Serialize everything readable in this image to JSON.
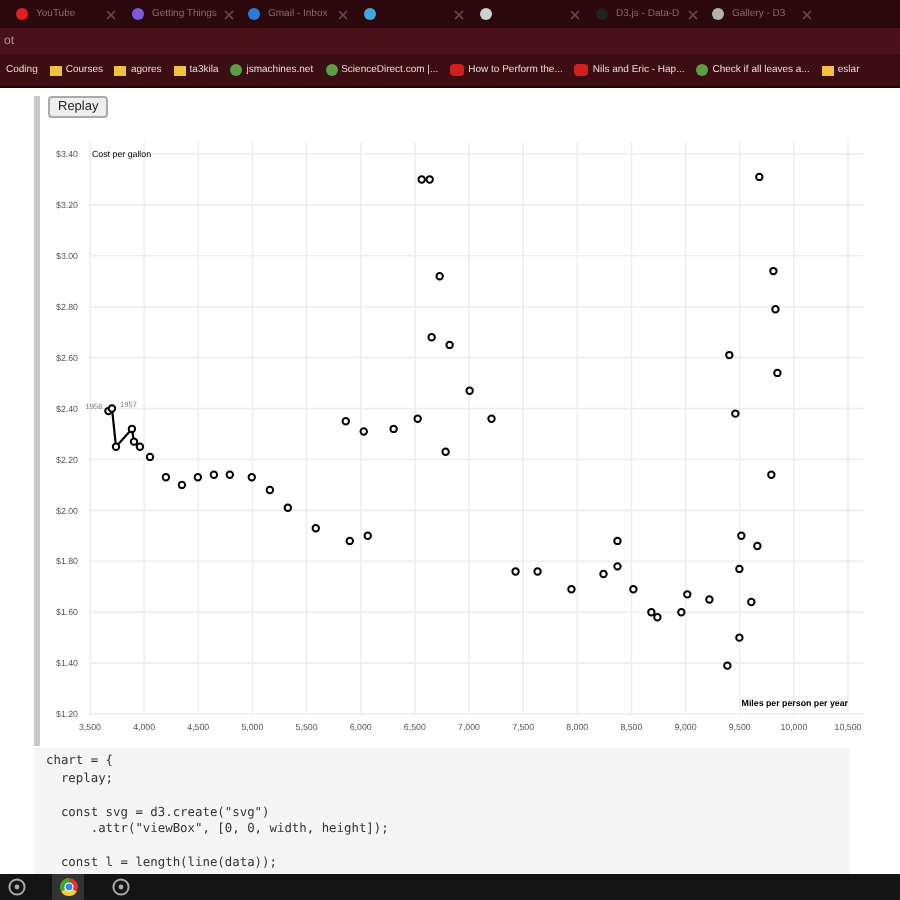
{
  "browser": {
    "tabs": [
      {
        "title": "YouTube",
        "color": "#e02020",
        "selected": false
      },
      {
        "title": "Getting Things",
        "color": "#7b5ce0",
        "selected": false
      },
      {
        "title": "Gmail - Inbox",
        "color": "#2a7ad8",
        "selected": false
      },
      {
        "color": "#40a8e0",
        "selected": false
      },
      {
        "color": "#d0d0d0",
        "selected": false
      },
      {
        "title": "D3.js - Data-D",
        "color": "#202020",
        "selected": false
      },
      {
        "title": "Gallery - D3",
        "color": "#b0b0b0",
        "selected": false
      }
    ],
    "address": "ot",
    "bookmarks": [
      {
        "label": "Coding",
        "kind": "plain"
      },
      {
        "label": "Courses",
        "kind": "folder"
      },
      {
        "label": "agores",
        "kind": "folder"
      },
      {
        "label": "ta3kila",
        "kind": "folder"
      },
      {
        "label": "jsmachines.net",
        "kind": "site"
      },
      {
        "label": "ScienceDirect.com |...",
        "kind": "site"
      },
      {
        "label": "How to Perform the...",
        "kind": "video"
      },
      {
        "label": "Nils and Eric - Hap...",
        "kind": "video"
      },
      {
        "label": "Check if all leaves a...",
        "kind": "site"
      },
      {
        "label": "eslar",
        "kind": "folder"
      }
    ]
  },
  "replay_button": "Replay",
  "chart": {
    "chart_data": {
      "type": "scatter",
      "xlabel": "Miles per person per year",
      "ylabel": "Cost per gallon",
      "xlim": [
        3500,
        10500
      ],
      "ylim": [
        1.2,
        3.4
      ],
      "xticks": [
        {
          "value": 3500,
          "label": "3,500"
        },
        {
          "value": 4000,
          "label": "4,000"
        },
        {
          "value": 4500,
          "label": "4,500"
        },
        {
          "value": 5000,
          "label": "5,000"
        },
        {
          "value": 5500,
          "label": "5,500"
        },
        {
          "value": 6000,
          "label": "6,000"
        },
        {
          "value": 6500,
          "label": "6,500"
        },
        {
          "value": 7000,
          "label": "7,000"
        },
        {
          "value": 7500,
          "label": "7,500"
        },
        {
          "value": 8000,
          "label": "8,000"
        },
        {
          "value": 8500,
          "label": "8,500"
        },
        {
          "value": 9000,
          "label": "9,000"
        },
        {
          "value": 9500,
          "label": "9,500"
        },
        {
          "value": 10000,
          "label": "10,000"
        },
        {
          "value": 10500,
          "label": "10,500"
        }
      ],
      "yticks": [
        {
          "value": 1.2,
          "label": "$1.20"
        },
        {
          "value": 1.4,
          "label": "$1.40"
        },
        {
          "value": 1.6,
          "label": "$1.60"
        },
        {
          "value": 1.8,
          "label": "$1.80"
        },
        {
          "value": 2.0,
          "label": "$2.00"
        },
        {
          "value": 2.2,
          "label": "$2.20"
        },
        {
          "value": 2.4,
          "label": "$2.40"
        },
        {
          "value": 2.6,
          "label": "$2.60"
        },
        {
          "value": 2.8,
          "label": "$2.80"
        },
        {
          "value": 3.0,
          "label": "$3.00"
        },
        {
          "value": 3.2,
          "label": "$3.20"
        },
        {
          "value": 3.4,
          "label": "$3.40"
        }
      ],
      "grid": true,
      "series": [
        {
          "color": "#000000",
          "x": [
            3670,
            3703,
            3740,
            3887,
            3906,
            3961
          ],
          "values": [
            2.39,
            2.4,
            2.25,
            2.32,
            2.27,
            2.25
          ]
        },
        {
          "color": "#000000",
          "x": [
            4054,
            4201,
            4349,
            4496,
            4644,
            4791,
            4994,
            5161,
            5327,
            5585,
            5899,
            6065,
            5862,
            6028,
            6304,
            6526,
            6563,
            6637,
            6729,
            6655,
            6821,
            6784,
            7006,
            7208,
            7430,
            7633,
            7946,
            8242,
            8371,
            8371,
            8518,
            8684,
            8740,
            8961,
            9016,
            9220,
            9386,
            9497,
            9607,
            9497,
            9515,
            9663,
            9404,
            9460,
            9792,
            9848,
            9830,
            9811,
            9681
          ],
          "values": [
            2.21,
            2.13,
            2.1,
            2.13,
            2.14,
            2.14,
            2.13,
            2.08,
            2.01,
            1.93,
            1.88,
            1.9,
            2.35,
            2.31,
            2.32,
            2.36,
            3.3,
            3.3,
            2.92,
            2.68,
            2.65,
            2.23,
            2.47,
            2.36,
            1.76,
            1.76,
            1.69,
            1.75,
            1.78,
            1.88,
            1.69,
            1.6,
            1.58,
            1.6,
            1.67,
            1.65,
            1.39,
            1.5,
            1.64,
            1.77,
            1.9,
            1.86,
            2.61,
            2.38,
            2.14,
            2.54,
            2.79,
            2.94,
            3.31
          ]
        }
      ],
      "annotations": [
        {
          "x": 3670,
          "y": 2.39,
          "text": "1956"
        },
        {
          "x": 3703,
          "y": 2.4,
          "text": "1957"
        }
      ]
    }
  },
  "code": [
    [
      "chart = {",
      "  replay;"
    ],
    [
      "  const svg = d3.create(\"svg\")",
      "      .attr(\"viewBox\", [0, 0, width, height]);"
    ],
    [
      "  const l = length(line(data));"
    ]
  ],
  "taskbar": [
    {
      "kind": "app",
      "selected": false
    },
    {
      "kind": "chrome",
      "selected": true
    },
    {
      "kind": "app",
      "selected": false
    }
  ]
}
